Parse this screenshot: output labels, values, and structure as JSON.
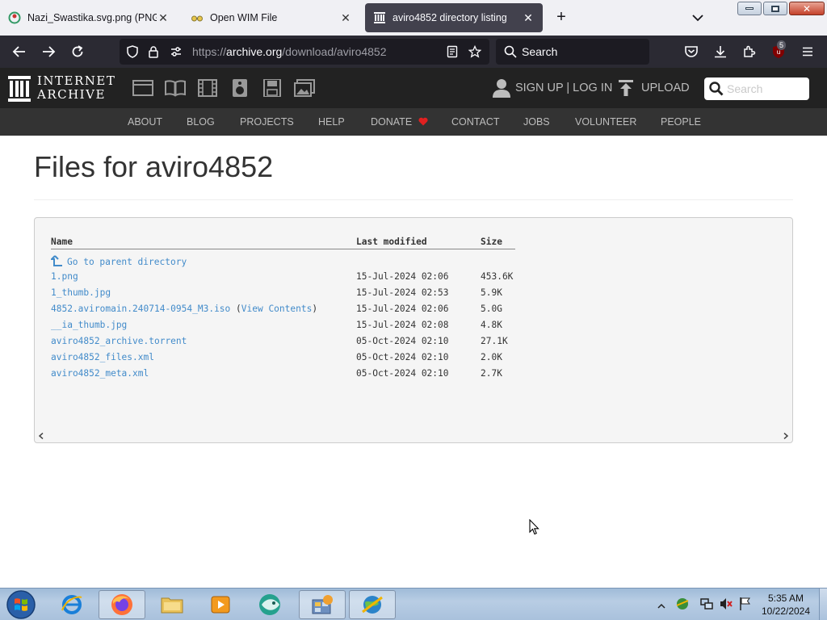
{
  "tabs": [
    {
      "title": "Nazi_Swastika.svg.png (PNG Im",
      "icon": "wikimedia-icon",
      "active": false
    },
    {
      "title": "Open WIM File",
      "icon": "glasses-icon",
      "active": false
    },
    {
      "title": "aviro4852 directory listing",
      "icon": "archive-icon",
      "active": true
    }
  ],
  "url": {
    "prefix": "https://",
    "domain": "archive.org",
    "path": "/download/aviro4852"
  },
  "browser_search": {
    "placeholder": "Search"
  },
  "extension_badge": "5",
  "ia": {
    "logo_line1": "INTERNET",
    "logo_line2": "ARCHIVE",
    "account": "SIGN UP | LOG IN",
    "upload": "UPLOAD",
    "search_placeholder": "Search",
    "nav": [
      "ABOUT",
      "BLOG",
      "PROJECTS",
      "HELP",
      "DONATE",
      "CONTACT",
      "JOBS",
      "VOLUNTEER",
      "PEOPLE"
    ]
  },
  "page": {
    "title": "Files for aviro4852"
  },
  "listing": {
    "headers": {
      "name": "Name",
      "modified": "Last modified",
      "size": "Size"
    },
    "parent_link": "Go to parent directory",
    "files": [
      {
        "name": "1.png",
        "modified": "15-Jul-2024 02:06",
        "size": "453.6K"
      },
      {
        "name": "1_thumb.jpg",
        "modified": "15-Jul-2024 02:53",
        "size": "5.9K"
      },
      {
        "name": "4852.aviromain.240714-0954_M3.iso",
        "extra": "View Contents",
        "modified": "15-Jul-2024 02:06",
        "size": "5.0G"
      },
      {
        "name": "__ia_thumb.jpg",
        "modified": "15-Jul-2024 02:08",
        "size": "4.8K"
      },
      {
        "name": "aviro4852_archive.torrent",
        "modified": "05-Oct-2024 02:10",
        "size": "27.1K"
      },
      {
        "name": "aviro4852_files.xml",
        "modified": "05-Oct-2024 02:10",
        "size": "2.0K"
      },
      {
        "name": "aviro4852_meta.xml",
        "modified": "05-Oct-2024 02:10",
        "size": "2.7K"
      }
    ]
  },
  "taskbar": {
    "time": "5:35 AM",
    "date": "10/22/2024"
  },
  "colors": {
    "link": "#428bca",
    "browser_chrome": "#2b2a33",
    "ia_header": "#222222",
    "donate_heart": "#e02020"
  }
}
